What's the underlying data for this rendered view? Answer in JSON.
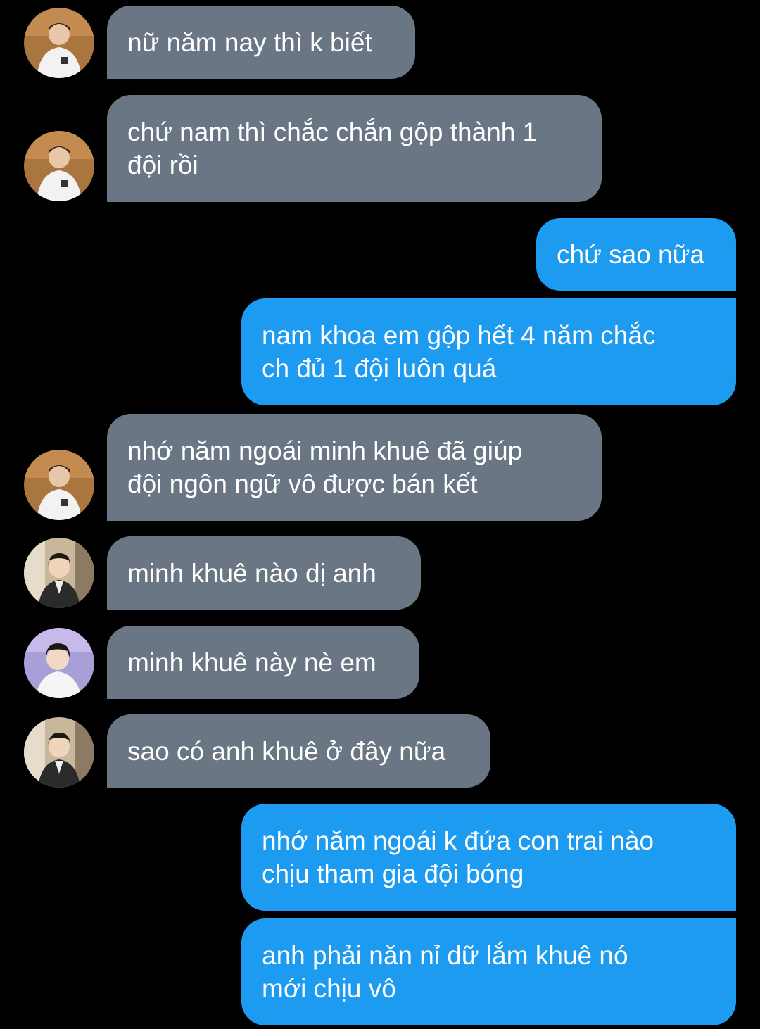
{
  "messages": [
    {
      "side": "in",
      "avatar": "person-a-avatar",
      "text": "nữ năm nay thì k biết"
    },
    {
      "side": "in",
      "avatar": "person-a-avatar",
      "text": "chứ nam thì chắc chắn gộp thành 1\nđội rồi"
    },
    {
      "side": "out",
      "text": "chứ sao nữa"
    },
    {
      "side": "out",
      "text": "nam khoa em gộp hết 4 năm chắc\nch đủ 1 đội luôn quá"
    },
    {
      "side": "in",
      "avatar": "person-a-avatar",
      "text": "nhớ năm ngoái minh khuê đã giúp\nđội ngôn ngữ vô được bán kết"
    },
    {
      "side": "in",
      "avatar": "person-b-avatar",
      "text": "minh khuê nào dị anh"
    },
    {
      "side": "in",
      "avatar": "person-c-avatar",
      "text": "minh khuê này nè em"
    },
    {
      "side": "in",
      "avatar": "person-b-avatar",
      "text": "sao có anh khuê ở đây nữa"
    },
    {
      "side": "out",
      "text": "nhớ năm ngoái k đứa con trai nào\nchịu tham gia đội bóng"
    },
    {
      "side": "out",
      "text": "anh phải năn nỉ dữ lắm khuê nó\nmới chịu vô"
    }
  ],
  "colors": {
    "background": "#000000",
    "incoming_bubble": "#6b7684",
    "outgoing_bubble": "#1d9bf0",
    "text": "#ffffff"
  }
}
